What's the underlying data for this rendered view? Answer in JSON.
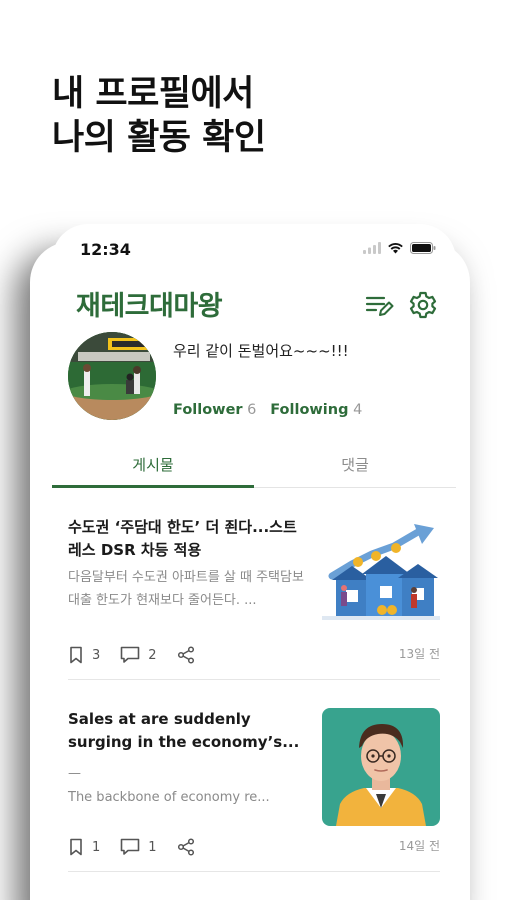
{
  "headline": {
    "line1": "내 프로필에서",
    "line2": "나의 활동 확인"
  },
  "status_bar": {
    "time": "12:34",
    "icons": [
      "signal-icon",
      "wifi-icon",
      "battery-icon"
    ]
  },
  "app": {
    "title": "재테크대마왕",
    "actions": [
      "edit-list-icon",
      "gear-icon"
    ],
    "accent_color": "#2e6c3a"
  },
  "profile": {
    "bio": "우리 같이 돈벌어요~~~!!!",
    "follower_label": "Follower",
    "follower_count": "6",
    "following_label": "Following",
    "following_count": "4"
  },
  "tabs": [
    {
      "label": "게시물",
      "active": true
    },
    {
      "label": "댓글",
      "active": false
    }
  ],
  "posts": [
    {
      "title": "수도권 ‘주담대 한도’ 더 죈다...스트레스 DSR 차등 적용",
      "excerpt": "다음달부터 수도권 아파트를 살 때 주택담보대출 한도가 현재보다 줄어든다. ...",
      "bookmarks": "3",
      "comments": "2",
      "date": "13일 전",
      "thumbnail": "housing-illustration"
    },
    {
      "title": "Sales at are suddenly surging in the economy’s...",
      "excerpt": "The backbone of economy re...",
      "bookmarks": "1",
      "comments": "1",
      "date": "14일 전",
      "thumbnail": "man-portrait-illustration"
    }
  ]
}
